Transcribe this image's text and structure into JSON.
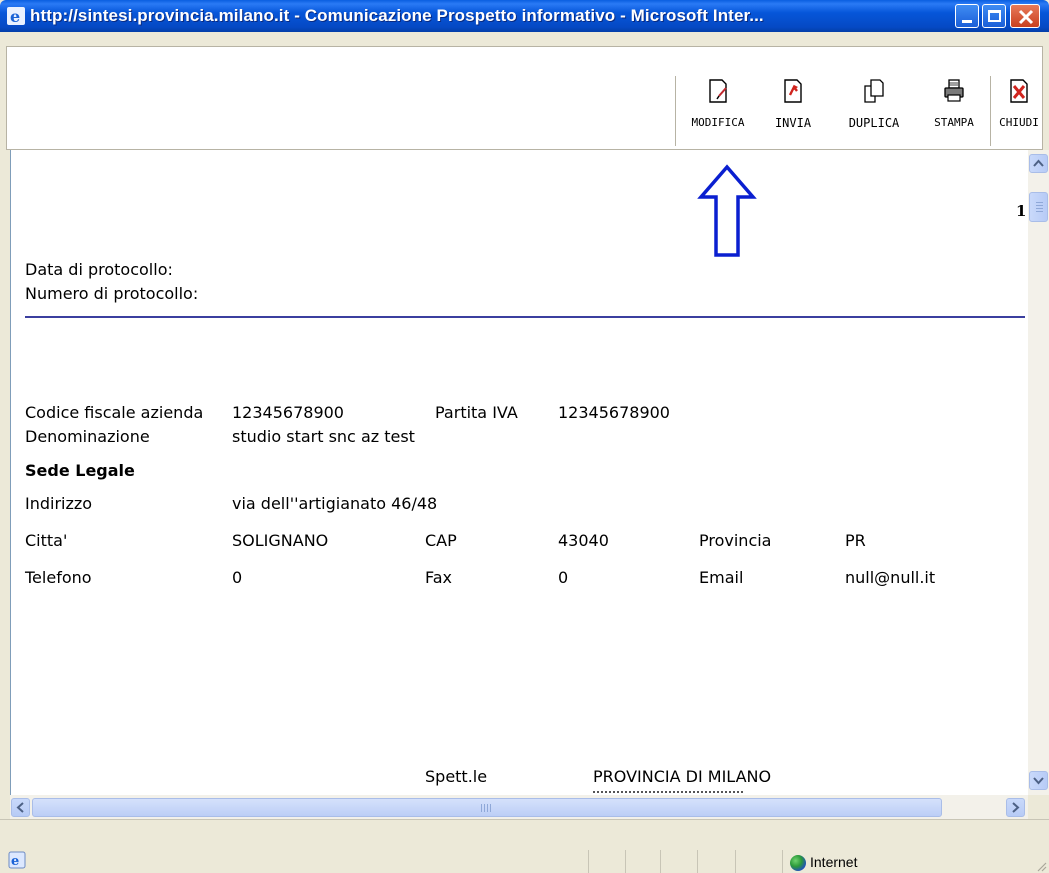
{
  "window": {
    "title": "http://sintesi.provincia.milano.it - Comunicazione Prospetto informativo - Microsoft Inter..."
  },
  "toolbar": {
    "buttons": [
      {
        "label": "MODIFICA",
        "icon": "edit-document-icon"
      },
      {
        "label": "INVIA",
        "icon": "send-document-icon"
      },
      {
        "label": "DUPLICA",
        "icon": "duplicate-icon"
      },
      {
        "label": "STAMPA",
        "icon": "printer-icon"
      },
      {
        "label": "CHIUDI",
        "icon": "close-document-icon"
      }
    ]
  },
  "document": {
    "page_number": "1",
    "protocol_date_label": "Data di protocollo:",
    "protocol_number_label": "Numero di protocollo:",
    "company": {
      "tax_code_label": "Codice fiscale azienda",
      "tax_code": "12345678900",
      "vat_label": "Partita IVA",
      "vat": "12345678900",
      "name_label": "Denominazione",
      "name": "studio start snc az test"
    },
    "legal_seat": {
      "heading": "Sede Legale",
      "address_label": "Indirizzo",
      "address": "via dell''artigianato 46/48",
      "city_label": "Citta'",
      "city": "SOLIGNANO",
      "cap_label": "CAP",
      "cap": "43040",
      "province_label": "Provincia",
      "province": "PR",
      "phone_label": "Telefono",
      "phone": "0",
      "fax_label": "Fax",
      "fax": "0",
      "email_label": "Email",
      "email": "null@null.it"
    },
    "recipient": {
      "label": "Spett.le",
      "name": "PROVINCIA DI MILANO"
    }
  },
  "statusbar": {
    "zone": "Internet"
  },
  "colors": {
    "annotation_arrow": "#0a1fd0",
    "title_bar": "#0656d9",
    "rule": "#3b3f9f"
  }
}
